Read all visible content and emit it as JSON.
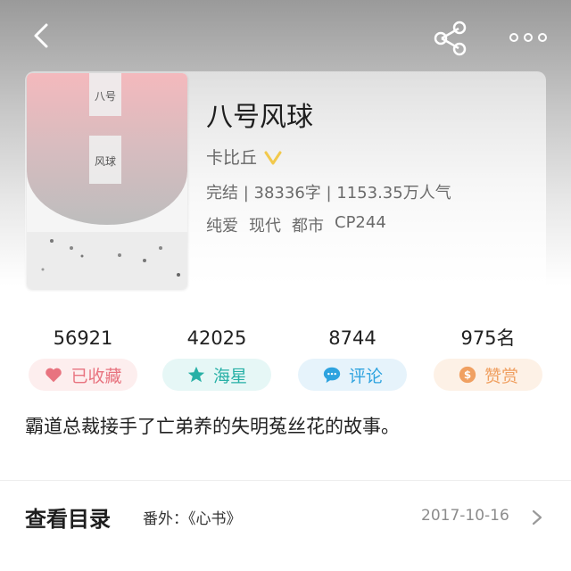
{
  "book": {
    "title": "八号风球",
    "author": "卡比丘",
    "status_line": "完结 | 38336字 | 1153.35万人气",
    "tags": [
      "纯爱",
      "现代",
      "都市",
      "CP244"
    ],
    "cover_text": [
      "八号",
      "风球"
    ]
  },
  "actions": [
    {
      "count": "56921",
      "label": "已收藏",
      "icon": "heart-icon",
      "color": "#e8737f",
      "bg": "#fdeeee"
    },
    {
      "count": "42025",
      "label": "海星",
      "icon": "star-icon",
      "color": "#27b0a6",
      "bg": "#e6f7f6"
    },
    {
      "count": "8744",
      "label": "评论",
      "icon": "comment-icon",
      "color": "#2ea3df",
      "bg": "#e6f3fb"
    },
    {
      "count": "975名",
      "label": "赞赏",
      "icon": "coin-icon",
      "color": "#f0a061",
      "bg": "#fdf1e6"
    }
  ],
  "synopsis": "霸道总裁接手了亡弟养的失明菟丝花的故事。",
  "toc": {
    "title": "查看目录",
    "latest_chapter": "番外：《心书》",
    "date": "2017-10-16"
  },
  "nav": {
    "back_icon": "back-arrow-icon",
    "share_icon": "share-icon",
    "more_icon": "more-dots-icon"
  }
}
